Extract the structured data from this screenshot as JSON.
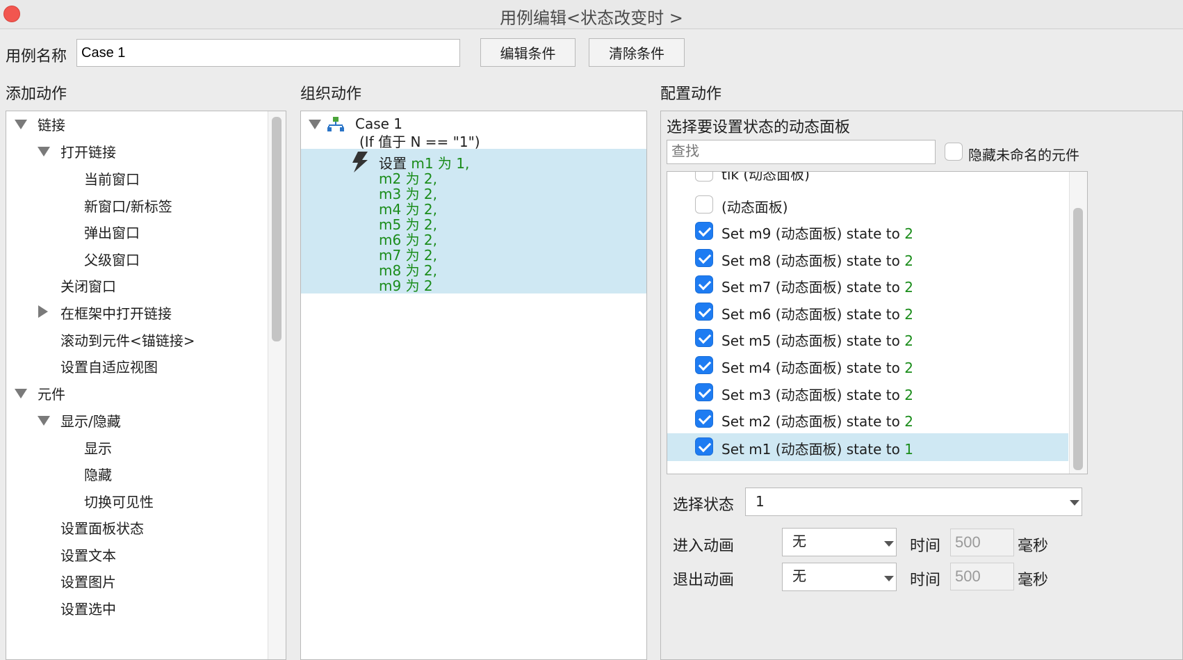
{
  "window": {
    "title": "用例编辑<状态改变时 >"
  },
  "case_name": {
    "label": "用例名称",
    "value": "Case 1"
  },
  "buttons": {
    "edit_condition": "编辑条件",
    "clear_condition": "清除条件"
  },
  "sections": {
    "add_actions": "添加动作",
    "organize_actions": "组织动作",
    "configure_actions": "配置动作"
  },
  "add_actions_tree": [
    {
      "label": "链接"
    },
    {
      "label": "打开链接"
    },
    {
      "label": "当前窗口"
    },
    {
      "label": "新窗口/新标签"
    },
    {
      "label": "弹出窗口"
    },
    {
      "label": "父级窗口"
    },
    {
      "label": "关闭窗口"
    },
    {
      "label": "在框架中打开链接"
    },
    {
      "label": "滚动到元件<锚链接>"
    },
    {
      "label": "设置自适应视图"
    },
    {
      "label": "元件"
    },
    {
      "label": "显示/隐藏"
    },
    {
      "label": "显示"
    },
    {
      "label": "隐藏"
    },
    {
      "label": "切换可见性"
    },
    {
      "label": "设置面板状态"
    },
    {
      "label": "设置文本"
    },
    {
      "label": "设置图片"
    },
    {
      "label": "设置选中"
    }
  ],
  "organize": {
    "case_title": "Case 1",
    "condition": "(If 值于 N == \"1\")",
    "action_prefix": "设置",
    "action_lines": [
      "m1 为 1,",
      "m2 为 2,",
      "m3 为 2,",
      "m4 为 2,",
      "m5 为 2,",
      "m6 为 2,",
      "m7 为 2,",
      "m8 为 2,",
      "m9 为 2"
    ]
  },
  "configure": {
    "panel_title": "选择要设置状态的动态面板",
    "search_placeholder": "查找",
    "hide_unnamed_label": "隐藏未命名的元件",
    "hide_unnamed_checked": false,
    "rows": [
      {
        "text": "tik (动态面板)",
        "state": "",
        "checked": false
      },
      {
        "text": "(动态面板)",
        "state": "",
        "checked": false
      },
      {
        "text": "Set m9 (动态面板) state to ",
        "state": "2",
        "checked": true
      },
      {
        "text": "Set m8 (动态面板) state to ",
        "state": "2",
        "checked": true
      },
      {
        "text": "Set m7 (动态面板) state to ",
        "state": "2",
        "checked": true
      },
      {
        "text": "Set m6 (动态面板) state to ",
        "state": "2",
        "checked": true
      },
      {
        "text": "Set m5 (动态面板) state to ",
        "state": "2",
        "checked": true
      },
      {
        "text": "Set m4 (动态面板) state to ",
        "state": "2",
        "checked": true
      },
      {
        "text": "Set m3 (动态面板) state to ",
        "state": "2",
        "checked": true
      },
      {
        "text": "Set m2 (动态面板) state to ",
        "state": "2",
        "checked": true
      },
      {
        "text": "Set m1 (动态面板) state to ",
        "state": "1",
        "checked": true
      }
    ],
    "select_state_label": "选择状态",
    "select_state_value": "1",
    "enter_anim_label": "进入动画",
    "enter_anim_value": "无",
    "exit_anim_label": "退出动画",
    "exit_anim_value": "无",
    "time_label": "时间",
    "time_value": "500",
    "ms_label": "毫秒"
  },
  "colors": {
    "selection": "#cfe8f3",
    "checkbox": "#1e7cf2",
    "green_text": "#1a8c1a",
    "close": "#f2564f"
  }
}
